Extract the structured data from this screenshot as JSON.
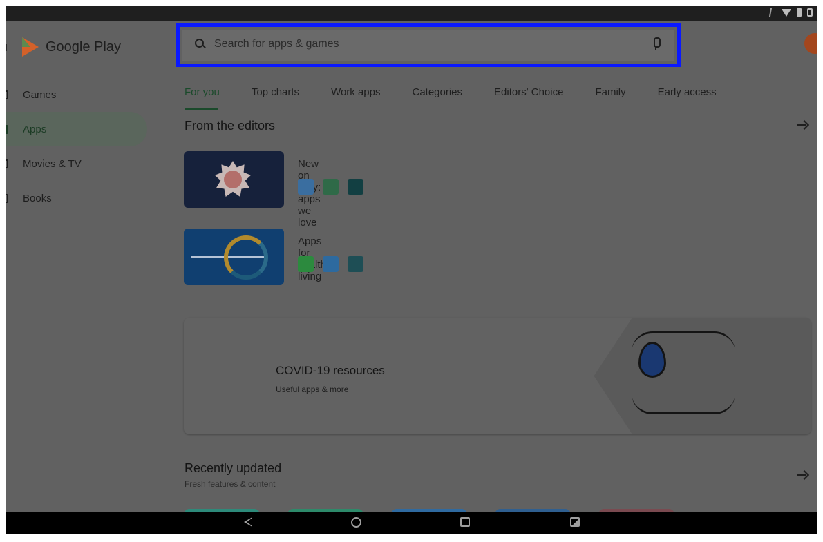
{
  "app": {
    "name": "Google Play"
  },
  "search": {
    "placeholder": "Search for apps & games"
  },
  "sidebar": {
    "items": [
      {
        "label": "Games",
        "icon": "gamepad-icon",
        "active": false
      },
      {
        "label": "Apps",
        "icon": "apps-grid-icon",
        "active": true
      },
      {
        "label": "Movies & TV",
        "icon": "film-icon",
        "active": false
      },
      {
        "label": "Books",
        "icon": "book-icon",
        "active": false
      }
    ]
  },
  "tabs": [
    {
      "label": "For you",
      "active": true
    },
    {
      "label": "Top charts",
      "active": false
    },
    {
      "label": "Work apps",
      "active": false
    },
    {
      "label": "Categories",
      "active": false
    },
    {
      "label": "Editors' Choice",
      "active": false
    },
    {
      "label": "Family",
      "active": false
    },
    {
      "label": "Early access",
      "active": false
    }
  ],
  "editors": {
    "title": "From the editors",
    "cards": [
      {
        "title": "New on Play: apps we love",
        "icon_colors": [
          "#3a6ea0",
          "#2f6a48",
          "#123f42"
        ]
      },
      {
        "title": "Apps for healthy living",
        "icon_colors": [
          "#2c8a3e",
          "#2d6a9f",
          "#1e4e55"
        ]
      }
    ]
  },
  "covid": {
    "title": "COVID-19 resources",
    "subtitle": "Useful apps & more"
  },
  "recent": {
    "title": "Recently updated",
    "subtitle": "Fresh features & content",
    "thumb_colors": [
      "#2d8a7a",
      "#2d8a6a",
      "#2f6aa0",
      "#2f5f90",
      "#7a4a50"
    ]
  },
  "colors": {
    "accent": "#1b4a2b",
    "highlight_border": "#0a19ff",
    "overlay": "#616161"
  }
}
